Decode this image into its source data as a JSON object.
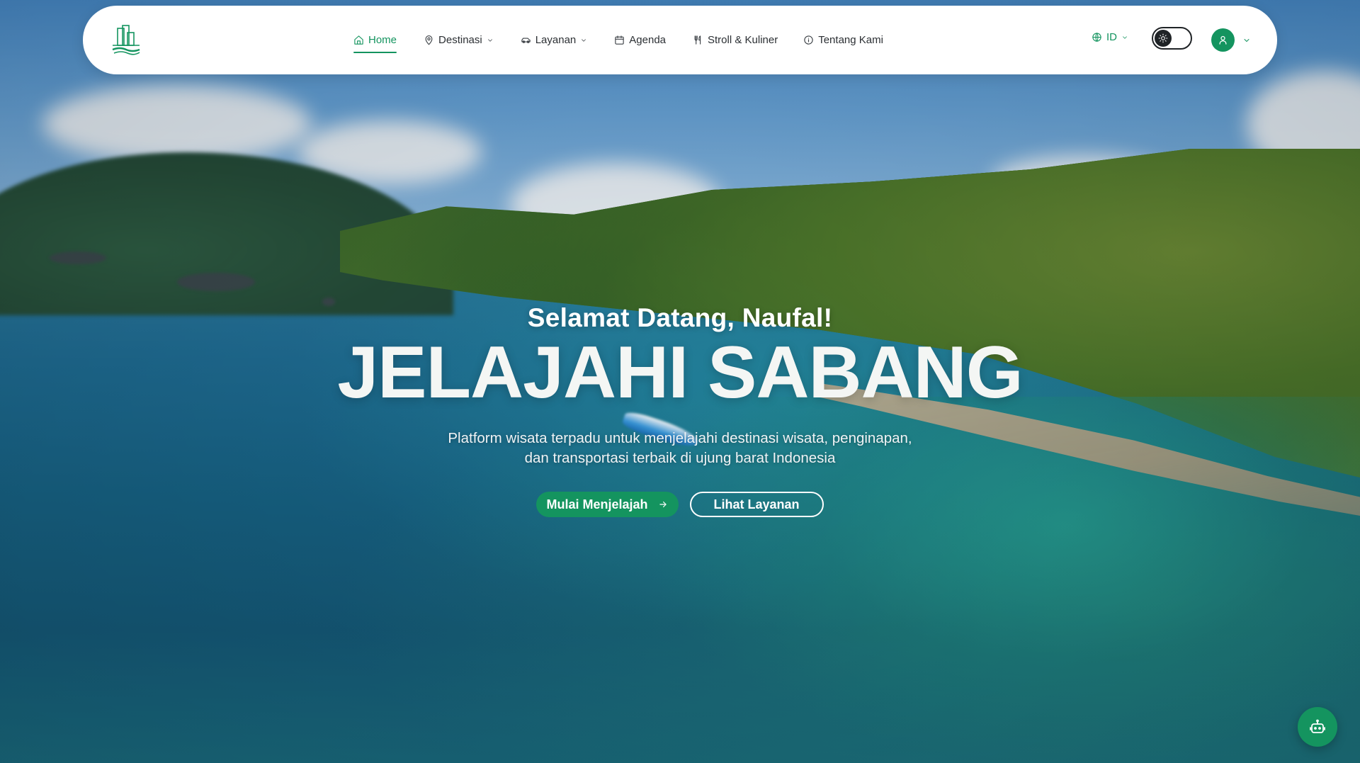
{
  "brand": {
    "logo_icon": "jaksabang-building-logo",
    "accent_color": "#14945f"
  },
  "nav": {
    "items": [
      {
        "label": "Home",
        "icon": "home-icon",
        "active": true,
        "has_dropdown": false
      },
      {
        "label": "Destinasi",
        "icon": "map-pin-icon",
        "active": false,
        "has_dropdown": true
      },
      {
        "label": "Layanan",
        "icon": "car-icon",
        "active": false,
        "has_dropdown": true
      },
      {
        "label": "Agenda",
        "icon": "calendar-icon",
        "active": false,
        "has_dropdown": false
      },
      {
        "label": "Stroll & Kuliner",
        "icon": "utensils-icon",
        "active": false,
        "has_dropdown": false
      },
      {
        "label": "Tentang Kami",
        "icon": "info-icon",
        "active": false,
        "has_dropdown": false
      }
    ],
    "language": {
      "label": "ID",
      "icon": "globe-icon"
    },
    "theme_toggle": {
      "icon": "sun-icon",
      "state": "light"
    },
    "user": {
      "icon": "user-icon"
    }
  },
  "hero": {
    "greeting": "Selamat Datang, Naufal!",
    "headline": "JELAJAHI SABANG",
    "subtitle_line1": "Platform wisata terpadu untuk menjelajahi destinasi wisata, penginapan,",
    "subtitle_line2": "dan transportasi terbaik di ujung barat Indonesia",
    "primary_cta": "Mulai Menjelajah",
    "secondary_cta": "Lihat Layanan"
  },
  "chatbot": {
    "icon": "bot-icon"
  }
}
